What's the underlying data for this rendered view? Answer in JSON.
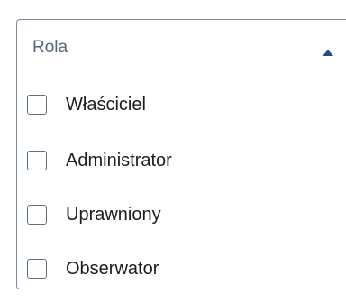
{
  "dropdown": {
    "label": "Rola",
    "expanded": true,
    "caret_icon": "caret-up-icon",
    "accent_color": "#1f4f8a",
    "options": [
      {
        "label": "Właściciel",
        "checked": false
      },
      {
        "label": "Administrator",
        "checked": false
      },
      {
        "label": "Uprawniony",
        "checked": false
      },
      {
        "label": "Obserwator",
        "checked": false
      }
    ]
  }
}
